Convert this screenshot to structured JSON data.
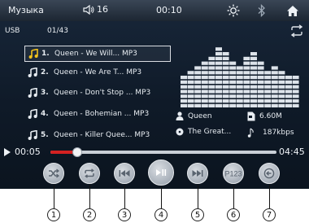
{
  "topbar": {
    "title": "Музыка",
    "volume": "16",
    "clock": "00:10"
  },
  "source": {
    "label": "USB",
    "count": "01/43"
  },
  "tracks": [
    {
      "num": "1.",
      "title": "Queen - We Will... MP3"
    },
    {
      "num": "2.",
      "title": "Queen - We Are T... MP3"
    },
    {
      "num": "3.",
      "title": "Queen - Don't Stop ... MP3"
    },
    {
      "num": "4.",
      "title": "Queen - Bohemian ... MP3"
    },
    {
      "num": "5.",
      "title": "Queen - Killer Quee... MP3"
    }
  ],
  "info": {
    "artist": "Queen",
    "album": "The Great...",
    "size": "6.60M",
    "bitrate": "187kbps"
  },
  "progress": {
    "current": "00:05",
    "total": "04:45",
    "fraction": 0.12
  },
  "spectrum_levels": [
    7,
    8,
    9,
    10,
    11,
    13,
    12,
    10,
    9,
    11,
    12,
    10,
    8,
    9,
    8,
    7,
    7
  ],
  "controls": [
    "shuffle-icon",
    "repeat-icon",
    "previous-icon",
    "play-pause-icon",
    "next-icon",
    "preset-icon",
    "back-icon"
  ],
  "control_labels": {
    "preset": "P123"
  },
  "callouts": [
    "1",
    "2",
    "3",
    "4",
    "5",
    "6",
    "7"
  ],
  "colors": {
    "accent": "#d42121",
    "screen_bg": "#0f1a28",
    "note": "#f2c21c"
  }
}
